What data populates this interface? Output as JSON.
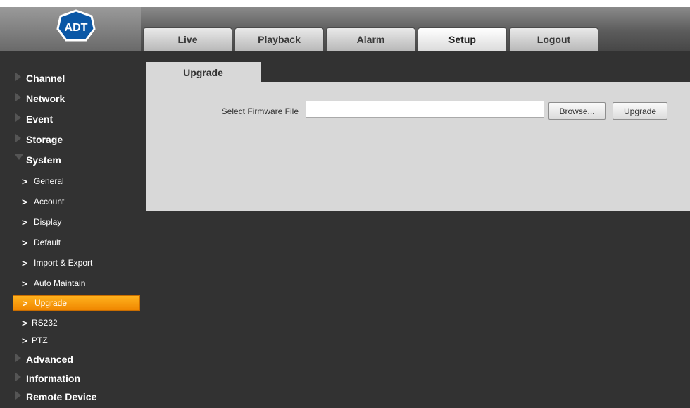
{
  "brand": {
    "logo_text": "ADT"
  },
  "tabs": [
    {
      "label": "Live"
    },
    {
      "label": "Playback"
    },
    {
      "label": "Alarm"
    },
    {
      "label": "Setup"
    },
    {
      "label": "Logout"
    }
  ],
  "active_tab": "Setup",
  "sidebar": {
    "sections": [
      {
        "label": "Channel"
      },
      {
        "label": "Network"
      },
      {
        "label": "Event"
      },
      {
        "label": "Storage"
      },
      {
        "label": "System"
      },
      {
        "label": "Advanced"
      },
      {
        "label": "Information"
      },
      {
        "label": "Remote Device"
      }
    ],
    "system_items": [
      {
        "label": "General"
      },
      {
        "label": "Account"
      },
      {
        "label": "Display"
      },
      {
        "label": "Default"
      },
      {
        "label": "Import & Export"
      },
      {
        "label": "Auto Maintain"
      },
      {
        "label": "Upgrade"
      },
      {
        "label": "RS232"
      },
      {
        "label": "PTZ"
      }
    ],
    "arrow_glyph": ">"
  },
  "content": {
    "tab_label": "Upgrade",
    "field_label": "Select Firmware File",
    "file_value": "",
    "browse_label": "Browse...",
    "upgrade_label": "Upgrade"
  },
  "colors": {
    "background": "#323232",
    "active_item": "#f59a10",
    "panel": "#d8d8d8"
  }
}
